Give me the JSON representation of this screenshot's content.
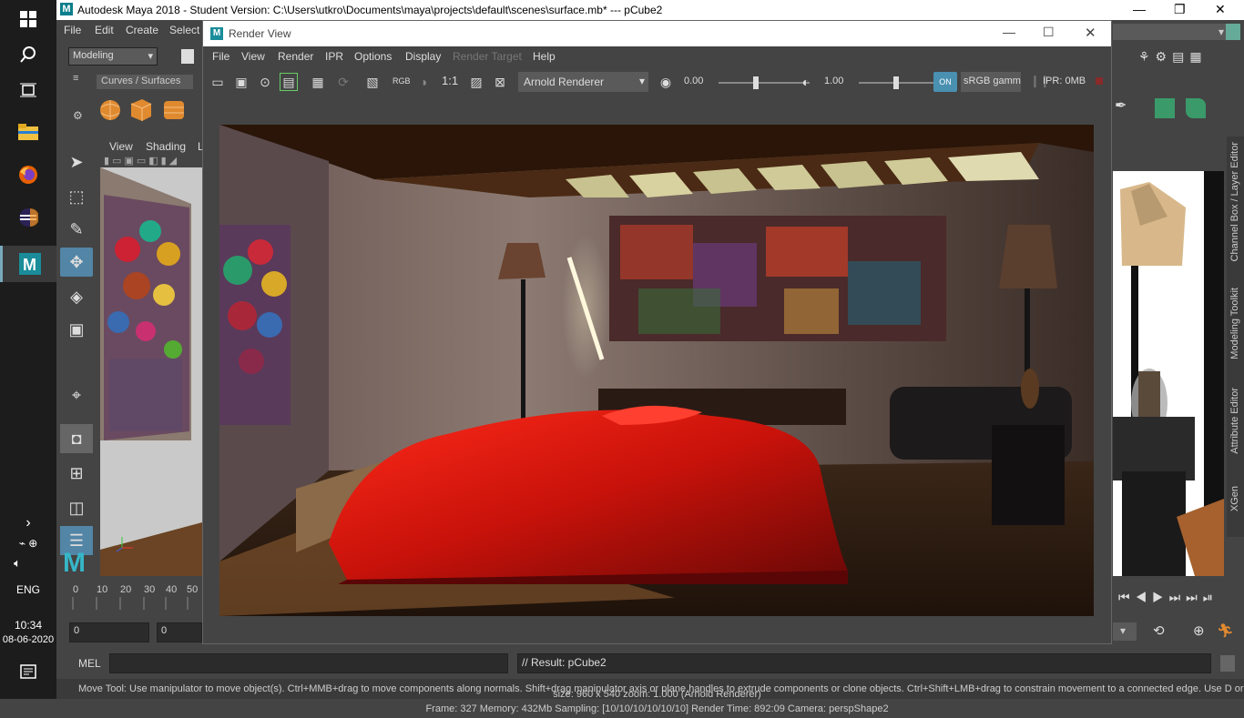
{
  "app": {
    "title": "Autodesk Maya 2018 - Student Version: C:\\Users\\utkro\\Documents\\maya\\projects\\default\\scenes\\surface.mb*   ---   pCube2",
    "menu": [
      "File",
      "Edit",
      "Create",
      "Select"
    ],
    "mode_select": "Modeling",
    "shelf_tab": "Curves / Surfaces",
    "viewport_menu": [
      "View",
      "Shading",
      "L"
    ],
    "timeline_ticks": [
      "0",
      "10",
      "20",
      "30",
      "40",
      "50"
    ],
    "frame_field_1": "0",
    "frame_field_2": "0",
    "cmd_label": "MEL",
    "cmd_result": "// Result: pCube2",
    "help_line": "Move Tool: Use manipulator to move object(s). Ctrl+MMB+drag to move components along normals. Shift+drag manipulator axis or plane handles to extrude components or clone objects. Ctrl+Shift+LMB+drag to constrain movement to a connected edge. Use D or INSERT to change the p",
    "side_tabs": [
      "Channel Box / Layer Editor",
      "Modeling Toolkit",
      "Attribute Editor",
      "XGen"
    ]
  },
  "taskbar": {
    "language": "ENG",
    "time": "10:34",
    "date": "08-06-2020"
  },
  "render_view": {
    "title": "Render View",
    "menu": [
      "File",
      "View",
      "Render",
      "IPR",
      "Options",
      "Display",
      "Render Target",
      "Help"
    ],
    "rgb_label": "RGB",
    "ratio_label": "1:1",
    "renderer": "Arnold Renderer",
    "exposure": "0.00",
    "gamma": "1.00",
    "color_space": "sRGB gamm",
    "ipr_mem": "IPR: 0MB",
    "status_size": "size: 960 x 540  zoom: 1.000     (Arnold Renderer)",
    "status_info": "Frame: 327    Memory: 432Mb    Sampling: [10/10/10/10/10/10]    Render Time: 892:09    Camera: perspShape2"
  }
}
